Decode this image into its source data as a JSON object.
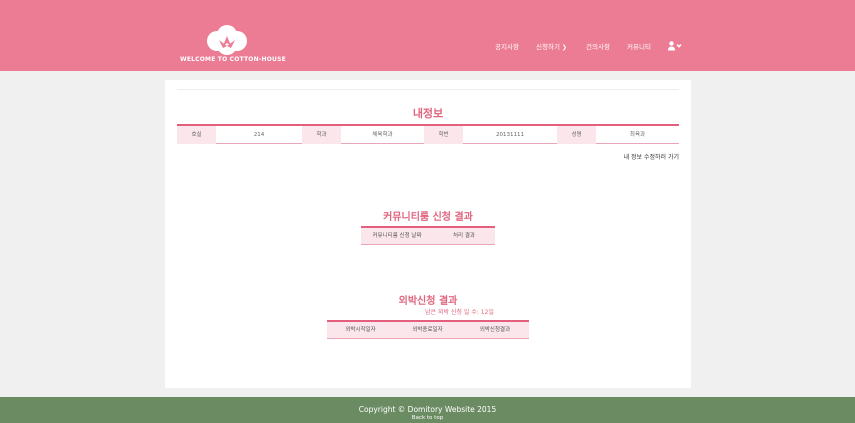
{
  "brand": {
    "logo_text": "WELCOME TO COTTON-HOUSE"
  },
  "nav": {
    "notice": "공지사항",
    "apply": "신청하기",
    "suggestion": "건의사항",
    "community": "커뮤니티"
  },
  "my_info": {
    "title": "내정보",
    "fields": [
      {
        "label": "호실",
        "value": "214"
      },
      {
        "label": "학과",
        "value": "체육학과"
      },
      {
        "label": "학번",
        "value": "20131111"
      },
      {
        "label": "성명",
        "value": "최육과"
      }
    ],
    "edit_link": "내 정보 수정하러 가기"
  },
  "community_result": {
    "title": "커뮤니티룸 신청 결과",
    "columns": [
      "커뮤니티룸 신청 날짜",
      "처리 결과"
    ]
  },
  "overnight_result": {
    "title": "외박신청 결과",
    "remaining_note": "남은 외박 신청 일 수: 12일",
    "columns": [
      "외박시작일자",
      "외박종료일자",
      "외박신청결과"
    ]
  },
  "footer": {
    "copyright": "Copyright © Domitory Website 2015",
    "back_to_top": "Back to top"
  },
  "colors": {
    "header": "#ec7c94",
    "accent": "#e35f7d",
    "title": "#e0667f",
    "footer": "#6b8b63"
  }
}
